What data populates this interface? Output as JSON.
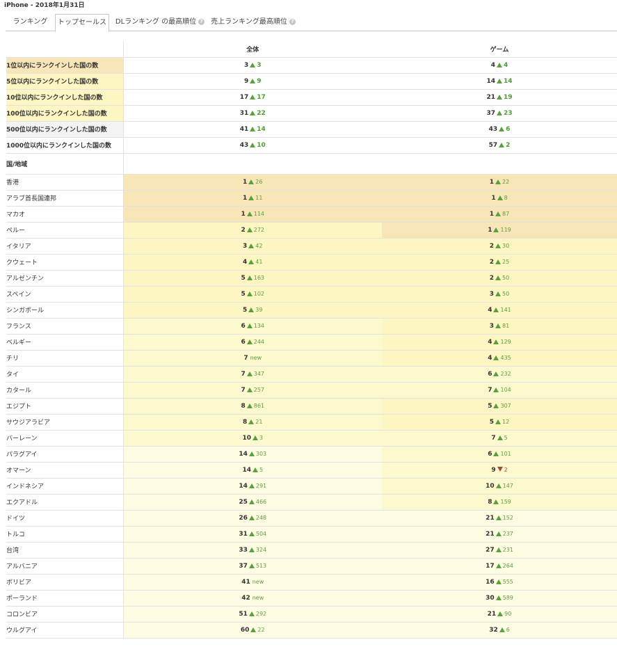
{
  "header": {
    "title": "iPhone - 2018年1月31日"
  },
  "tabs": [
    {
      "label": "ランキング",
      "active": false,
      "help": false
    },
    {
      "label": "トップセールス",
      "active": true,
      "help": false
    },
    {
      "label": "DLランキング の最高順位",
      "active": false,
      "help": true
    },
    {
      "label": "売上ランキング最高順位",
      "active": false,
      "help": true
    }
  ],
  "table": {
    "columns": [
      "全体",
      "ゲーム"
    ],
    "summary": [
      {
        "label": "1位以内にランクインした国の数",
        "all": "3",
        "all_change": "3",
        "game": "4",
        "game_change": "4"
      },
      {
        "label": "5位以内にランクインした国の数",
        "all": "9",
        "all_change": "9",
        "game": "14",
        "game_change": "14"
      },
      {
        "label": "10位以内にランクインした国の数",
        "all": "17",
        "all_change": "17",
        "game": "21",
        "game_change": "19"
      },
      {
        "label": "100位以内にランクインした国の数",
        "all": "31",
        "all_change": "22",
        "game": "37",
        "game_change": "23"
      },
      {
        "label": "500位以内にランクインした国の数",
        "all": "41",
        "all_change": "14",
        "game": "43",
        "game_change": "6"
      },
      {
        "label": "1000位以内にランクインした国の数",
        "all": "43",
        "all_change": "10",
        "game": "57",
        "game_change": "2"
      }
    ],
    "country_header": "国/地域",
    "countries": [
      {
        "name": "香港",
        "all": "1",
        "all_change": "26",
        "game": "1",
        "game_change": "22"
      },
      {
        "name": "アラブ首長国連邦",
        "all": "1",
        "all_change": "11",
        "game": "1",
        "game_change": "8"
      },
      {
        "name": "マカオ",
        "all": "1",
        "all_change": "114",
        "game": "1",
        "game_change": "87"
      },
      {
        "name": "ペルー",
        "all": "2",
        "all_change": "272",
        "game": "1",
        "game_change": "119"
      },
      {
        "name": "イタリア",
        "all": "3",
        "all_change": "42",
        "game": "2",
        "game_change": "30"
      },
      {
        "name": "クウェート",
        "all": "4",
        "all_change": "41",
        "game": "2",
        "game_change": "25"
      },
      {
        "name": "アルゼンチン",
        "all": "5",
        "all_change": "163",
        "game": "2",
        "game_change": "50"
      },
      {
        "name": "スペイン",
        "all": "5",
        "all_change": "102",
        "game": "3",
        "game_change": "50"
      },
      {
        "name": "シンガポール",
        "all": "5",
        "all_change": "39",
        "game": "4",
        "game_change": "141"
      },
      {
        "name": "フランス",
        "all": "6",
        "all_change": "134",
        "game": "3",
        "game_change": "81"
      },
      {
        "name": "ベルギー",
        "all": "6",
        "all_change": "244",
        "game": "4",
        "game_change": "129"
      },
      {
        "name": "チリ",
        "all": "7",
        "all_change": "new",
        "game": "4",
        "game_change": "435"
      },
      {
        "name": "タイ",
        "all": "7",
        "all_change": "347",
        "game": "6",
        "game_change": "232"
      },
      {
        "name": "カタール",
        "all": "7",
        "all_change": "257",
        "game": "7",
        "game_change": "104"
      },
      {
        "name": "エジプト",
        "all": "8",
        "all_change": "861",
        "game": "5",
        "game_change": "307"
      },
      {
        "name": "サウジアラビア",
        "all": "8",
        "all_change": "21",
        "game": "5",
        "game_change": "12"
      },
      {
        "name": "バーレーン",
        "all": "10",
        "all_change": "3",
        "game": "7",
        "game_change": "5"
      },
      {
        "name": "パラグアイ",
        "all": "14",
        "all_change": "303",
        "game": "6",
        "game_change": "101"
      },
      {
        "name": "オマーン",
        "all": "14",
        "all_change": "5",
        "game": "9",
        "game_change": "2"
      },
      {
        "name": "インドネシア",
        "all": "14",
        "all_change": "291",
        "game": "10",
        "game_change": "147"
      },
      {
        "name": "エクアドル",
        "all": "25",
        "all_change": "466",
        "game": "8",
        "game_change": "159"
      },
      {
        "name": "ドイツ",
        "all": "26",
        "all_change": "248",
        "game": "21",
        "game_change": "152"
      },
      {
        "name": "トルコ",
        "all": "31",
        "all_change": "504",
        "game": "21",
        "game_change": "237"
      },
      {
        "name": "台湾",
        "all": "33",
        "all_change": "324",
        "game": "27",
        "game_change": "231"
      },
      {
        "name": "アルバニア",
        "all": "37",
        "all_change": "513",
        "game": "17",
        "game_change": "264"
      },
      {
        "name": "ボリビア",
        "all": "41",
        "all_change": "new",
        "game": "16",
        "game_change": "555"
      },
      {
        "name": "ポーランド",
        "all": "42",
        "all_change": "new",
        "game": "30",
        "game_change": "589"
      },
      {
        "name": "コロンビア",
        "all": "51",
        "all_change": "292",
        "game": "21",
        "game_change": "90"
      },
      {
        "name": "ウルグアイ",
        "all": "60",
        "all_change": "22",
        "game": "32",
        "game_change": "6"
      }
    ]
  },
  "colors": {
    "rank1": "#f8e6b8",
    "rank2_5": "#fdf5c2",
    "rank6_10": "#fdf9cf",
    "rank11_plus": "#fefde4",
    "up": "#5aa03c",
    "down": "#a34a3e"
  },
  "icons": {
    "help": "question-circle-icon",
    "up": "triangle-up-icon",
    "down": "triangle-down-icon"
  }
}
